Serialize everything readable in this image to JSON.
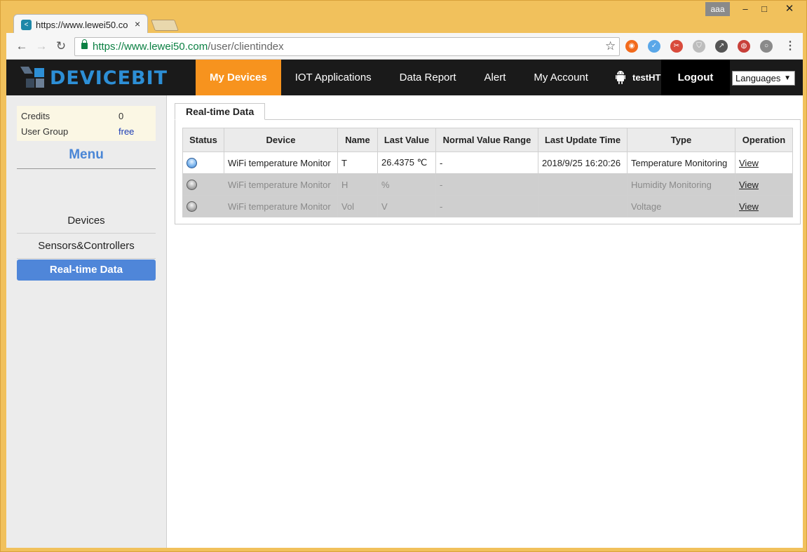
{
  "window": {
    "profile_name": "aaa",
    "minimize": "–",
    "maximize": "□",
    "close": "✕"
  },
  "tab": {
    "title": "https://www.lewei50.co",
    "close": "×"
  },
  "toolbar": {
    "url_host": "https://www.lewei50.com",
    "url_path": "/user/clientindex",
    "back": "←",
    "forward": "→",
    "reload": "↻",
    "star": "☆",
    "menu": "⋮",
    "extensions": [
      {
        "name": "ext-orange-icon",
        "glyph": "◉",
        "color": "#f26a1b"
      },
      {
        "name": "ext-blue-check-icon",
        "glyph": "✓",
        "color": "#5aa7e8"
      },
      {
        "name": "ext-red-icon",
        "glyph": "✂",
        "color": "#d94b3c"
      },
      {
        "name": "ext-shield-icon",
        "glyph": "⛉",
        "color": "#bdbdbd"
      },
      {
        "name": "ext-chart-icon",
        "glyph": "↗",
        "color": "#555555"
      },
      {
        "name": "ext-globe-icon",
        "glyph": "◍",
        "color": "#c8403a"
      },
      {
        "name": "ext-circle-icon",
        "glyph": "○",
        "color": "#8a8a8a"
      }
    ]
  },
  "site": {
    "logo_text": "DEVICEBIT",
    "nav": [
      {
        "label": "My Devices",
        "active": true
      },
      {
        "label": "IOT Applications",
        "active": false
      },
      {
        "label": "Data Report",
        "active": false
      },
      {
        "label": "Alert",
        "active": false
      },
      {
        "label": "My Account",
        "active": false
      }
    ],
    "username": "testHT",
    "logout": "Logout",
    "languages": "Languages",
    "caret": "▼"
  },
  "sidebar": {
    "credits_label": "Credits",
    "credits_value": "0",
    "group_label": "User Group",
    "group_value": "free",
    "menu_title": "Menu",
    "items": [
      {
        "label": "Devices",
        "active": false
      },
      {
        "label": "Sensors&Controllers",
        "active": false
      },
      {
        "label": "Real-time Data",
        "active": true
      }
    ]
  },
  "panel": {
    "tab_label": "Real-time Data",
    "columns": [
      "Status",
      "Device",
      "Name",
      "Last Value",
      "Normal Value Range",
      "Last Update Time",
      "Type",
      "Operation"
    ],
    "rows": [
      {
        "status": "online",
        "device": "WiFi temperature Monitor",
        "name": "T",
        "last_value": "26.4375 ℃",
        "range": "-",
        "updated": "2018/9/25 16:20:26",
        "type": "Temperature Monitoring",
        "operation": "View"
      },
      {
        "status": "offline",
        "device": "WiFi temperature Monitor",
        "name": "H",
        "last_value": "%",
        "range": "-",
        "updated": "",
        "type": "Humidity Monitoring",
        "operation": "View"
      },
      {
        "status": "offline",
        "device": "WiFi temperature Monitor",
        "name": "Vol",
        "last_value": "V",
        "range": "-",
        "updated": "",
        "type": "Voltage",
        "operation": "View"
      }
    ]
  }
}
